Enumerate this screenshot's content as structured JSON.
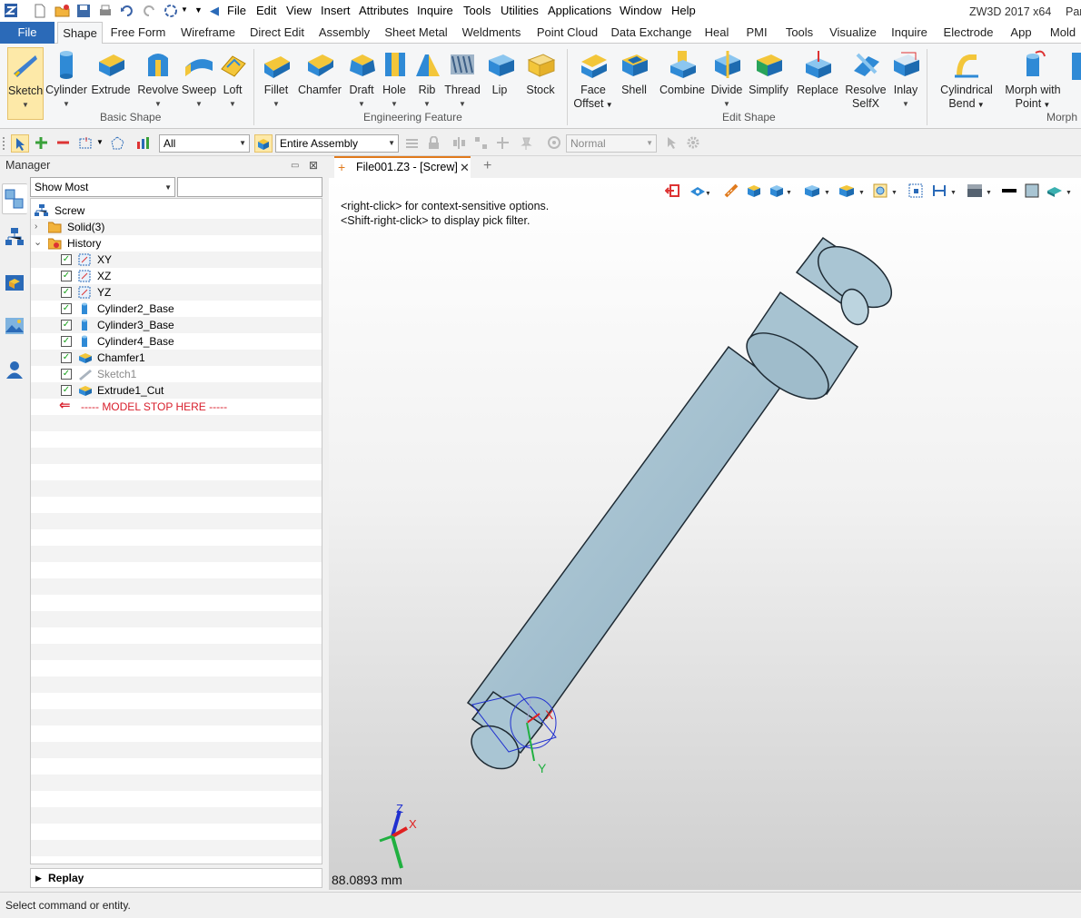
{
  "title": {
    "app_name": "ZW3D 2017  x64",
    "doc_name_partial": "Par",
    "menu": [
      "File",
      "Edit",
      "View",
      "Insert",
      "Attributes",
      "Inquire",
      "Tools",
      "Utilities",
      "Applications",
      "Window",
      "Help"
    ]
  },
  "ribbon_tabs": [
    "File",
    "Shape",
    "Free Form",
    "Wireframe",
    "Direct Edit",
    "Assembly",
    "Sheet Metal",
    "Weldments",
    "Point Cloud",
    "Data Exchange",
    "Heal",
    "PMI",
    "Tools",
    "Visualize",
    "Inquire",
    "Electrode",
    "App",
    "Mold"
  ],
  "active_tab": "Shape",
  "ribbon": {
    "basic_shape": {
      "label": "Basic Shape",
      "buttons": [
        "Sketch",
        "Cylinder",
        "Extrude",
        "Revolve",
        "Sweep",
        "Loft"
      ]
    },
    "engineering_feature": {
      "label": "Engineering Feature",
      "buttons": [
        "Fillet",
        "Chamfer",
        "Draft",
        "Hole",
        "Rib",
        "Thread",
        "Lip",
        "Stock"
      ]
    },
    "edit_shape": {
      "label": "Edit Shape",
      "buttons": [
        [
          "Face",
          "Offset"
        ],
        [
          "Shell"
        ],
        [
          "Combine"
        ],
        [
          "Divide"
        ],
        [
          "Simplify"
        ],
        [
          "Replace"
        ],
        [
          "Resolve",
          "SelfX"
        ],
        [
          "Inlay"
        ]
      ]
    },
    "morph": {
      "label": "Morph",
      "buttons": [
        [
          "Cylindrical",
          "Bend"
        ],
        [
          "Morph with",
          "Point"
        ]
      ]
    }
  },
  "toolbar": {
    "filter_value": "All",
    "scope_value": "Entire Assembly",
    "display_value": "Normal"
  },
  "manager": {
    "title": "Manager",
    "show_filter": "Show Most",
    "search_value": "",
    "tree": {
      "root": "Screw",
      "solid": "Solid(3)",
      "history": "History",
      "items": [
        "XY",
        "XZ",
        "YZ",
        "Cylinder2_Base",
        "Cylinder3_Base",
        "Cylinder4_Base",
        "Chamfer1",
        "Sketch1",
        "Extrude1_Cut"
      ],
      "stop": "----- MODEL STOP HERE -----"
    },
    "replay": "Replay"
  },
  "document": {
    "tab_label": "File001.Z3 - [Screw]",
    "hint_line1": "<right-click> for context-sensitive options.",
    "hint_line2": "<Shift-right-click> to display pick filter.",
    "measure": "88.0893 mm",
    "axis_labels": {
      "x": "X",
      "y": "Y",
      "z": "Z"
    }
  },
  "status": "Select command or entity.",
  "colors": {
    "file_tab": "#2b6ab8",
    "model_fill": "#a9c5d3",
    "check_green": "#17a01a",
    "stop_red": "#d81e2b",
    "axis_x": "#e02020",
    "axis_y": "#20b040",
    "axis_z": "#2030d0"
  }
}
